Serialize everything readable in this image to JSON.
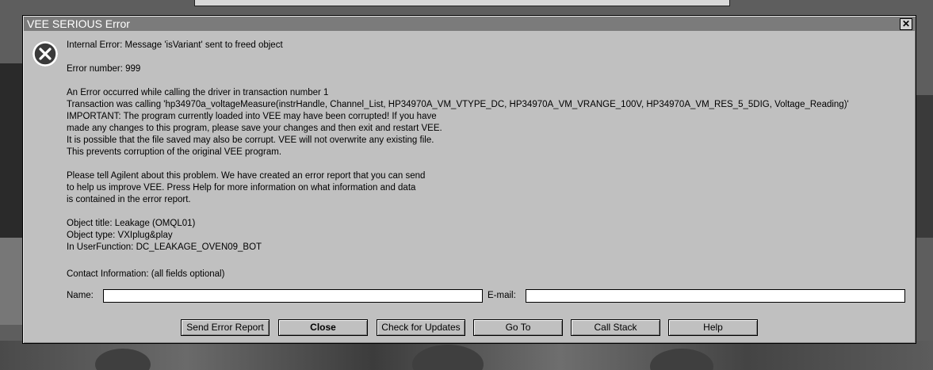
{
  "window": {
    "title": "VEE SERIOUS Error",
    "close_glyph": "✕"
  },
  "message": {
    "line1": "Internal Error:  Message 'isVariant' sent to freed object",
    "error_number": "Error number: 999",
    "line_a": "An Error occurred while calling the driver in transaction number 1",
    "line_b": "Transaction was calling 'hp34970a_voltageMeasure(instrHandle, Channel_List, HP34970A_VM_VTYPE_DC, HP34970A_VM_VRANGE_100V, HP34970A_VM_RES_5_5DIG, Voltage_Reading)'",
    "line_c": "IMPORTANT: The program currently loaded into VEE may have been corrupted! If you have",
    "line_d": "made any changes to this program, please save your changes and then exit and restart VEE.",
    "line_e": "It is possible that the file saved may also be corrupt. VEE will not overwrite any existing file.",
    "line_f": "This prevents corruption of the original VEE program.",
    "line_g": "Please tell Agilent about this problem. We have created an error report that you can send",
    "line_h": "to help us improve VEE.  Press Help for more information on what information and data",
    "line_i": "is contained in the error report.",
    "object_title": "Object title: Leakage (OMQL01)",
    "object_type": "Object type: VXIplug&play",
    "user_function": "In UserFunction: DC_LEAKAGE_OVEN09_BOT"
  },
  "contact": {
    "heading": "Contact Information: (all fields optional)",
    "name_label": "Name:",
    "name_value": "",
    "email_label": "E-mail:",
    "email_value": ""
  },
  "buttons": {
    "send_error_report": "Send Error Report",
    "close": "Close",
    "check_for_updates": "Check for Updates",
    "go_to": "Go To",
    "call_stack": "Call Stack",
    "help": "Help"
  },
  "icons": {
    "error": "error-circle-x-icon"
  },
  "colors": {
    "dialog_bg": "#c0c0c0",
    "titlebar_bg": "#7b7b7b",
    "icon_bg": "#3a3a3a"
  }
}
